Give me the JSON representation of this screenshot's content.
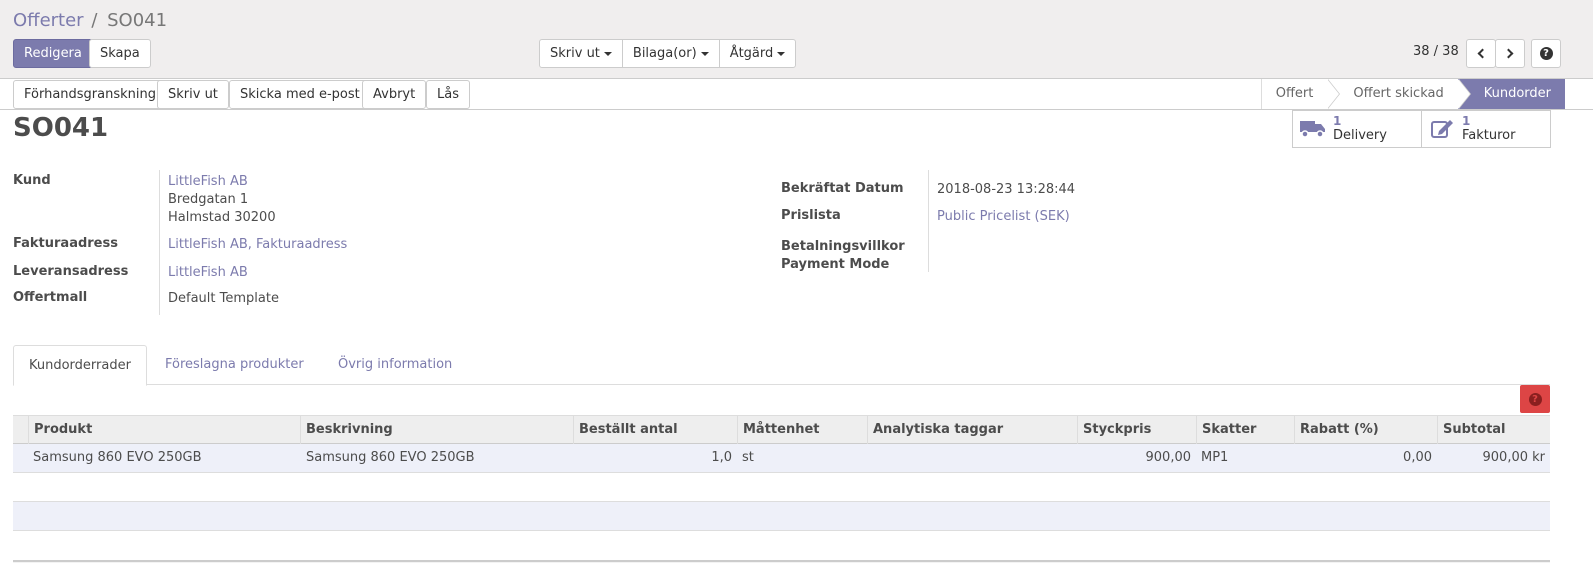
{
  "breadcrumb": {
    "parent": "Offerter",
    "separator": "/",
    "current": "SO041"
  },
  "toolbar": {
    "edit_label": "Redigera",
    "create_label": "Skapa",
    "print_label": "Skriv ut",
    "attachments_label": "Bilaga(or)",
    "action_label": "Åtgärd"
  },
  "pager": {
    "value": "38 / 38"
  },
  "header_buttons": {
    "preview": "Förhandsgranskning",
    "print": "Skriv ut",
    "email": "Skicka med e-post",
    "cancel": "Avbryt",
    "lock": "Lås"
  },
  "statusbar": [
    "Offert",
    "Offert skickad",
    "Kundorder"
  ],
  "statusbar_active": "Kundorder",
  "record": {
    "name": "SO041"
  },
  "smart_buttons": [
    {
      "count": "1",
      "label": "Delivery",
      "icon": "truck-icon"
    },
    {
      "count": "1",
      "label": "Fakturor",
      "icon": "edit-icon"
    }
  ],
  "fields_left": {
    "customer_label": "Kund",
    "customer_name": "LittleFish AB",
    "customer_street": "Bredgatan 1",
    "customer_city": "Halmstad 30200",
    "invoice_label": "Fakturaadress",
    "invoice_value": "LittleFish AB, Fakturaadress",
    "delivery_label": "Leveransadress",
    "delivery_value": "LittleFish AB",
    "template_label": "Offertmall",
    "template_value": "Default Template"
  },
  "fields_right": {
    "confirmed_label": "Bekräftat Datum",
    "confirmed_value": "2018-08-23 13:28:44",
    "pricelist_label": "Prislista",
    "pricelist_value": "Public Pricelist (SEK)",
    "payment_terms_label": "Betalningsvillkor",
    "payment_mode_label": "Payment Mode"
  },
  "tabs": [
    "Kundorderrader",
    "Föreslagna produkter",
    "Övrig information"
  ],
  "table": {
    "columns": [
      "Produkt",
      "Beskrivning",
      "Beställt antal",
      "Måttenhet",
      "Analytiska taggar",
      "Styckpris",
      "Skatter",
      "Rabatt (%)",
      "Subtotal"
    ],
    "rows": [
      [
        "Samsung 860 EVO 250GB",
        "Samsung 860 EVO 250GB",
        "1,0",
        "st",
        "",
        "900,00",
        "MP1",
        "0,00",
        "900,00 kr"
      ]
    ]
  },
  "colors": {
    "primary": "#7c7bad",
    "danger": "#dd4545",
    "panel_bg": "#f0eeee"
  }
}
